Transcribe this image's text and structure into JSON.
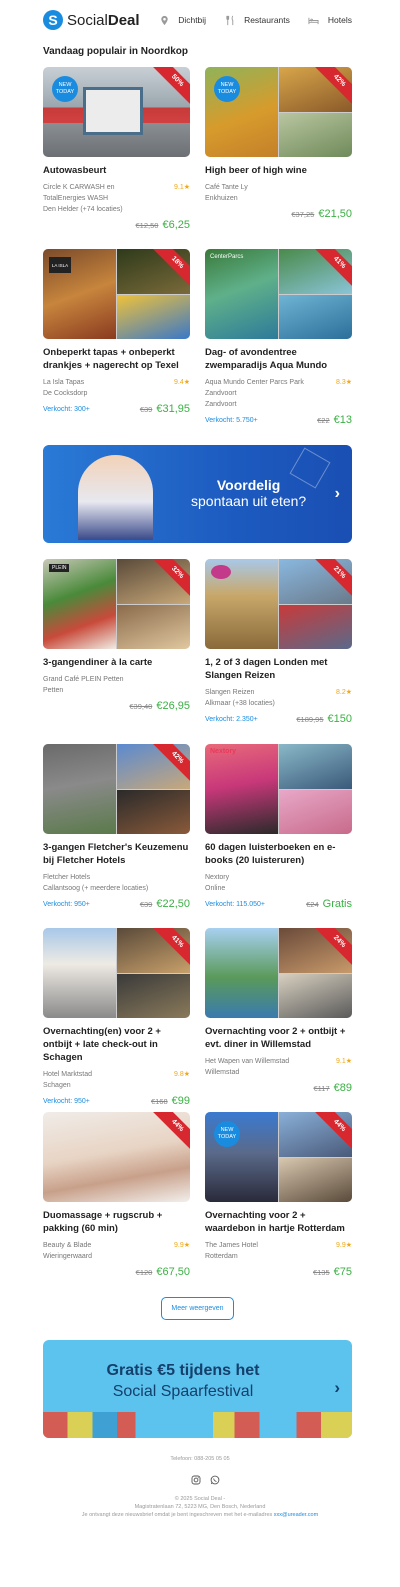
{
  "header": {
    "logo": "S",
    "logo_social": "Social",
    "logo_deal": "Deal",
    "nav": [
      {
        "label": "Dichtbij",
        "icon": "location-pin-icon"
      },
      {
        "label": "Restaurants",
        "icon": "fork-knife-icon"
      },
      {
        "label": "Hotels",
        "icon": "bed-icon"
      }
    ]
  },
  "section_title": "Vandaag populair in Noordkop",
  "deals": [
    {
      "title": "Autowasbeurt",
      "meta": [
        "Circle K CARWASH en",
        "TotalEnergies WASH",
        "Den Helder (+74 locaties)"
      ],
      "rating": "9.1★",
      "sold": "",
      "old_price": "€12,50",
      "new_price": "€6,25",
      "discount": "50%",
      "new_badge": true
    },
    {
      "title": "High beer of high wine",
      "meta": [
        "Café Tante Ly",
        "Enkhuizen"
      ],
      "rating": "",
      "sold": "",
      "old_price": "€37,25",
      "new_price": "€21,50",
      "discount": "42%",
      "new_badge": true
    },
    {
      "title": "Onbeperkt tapas + onbeperkt drankjes + nagerecht op Texel",
      "meta": [
        "La Isla Tapas",
        "De Cocksdorp"
      ],
      "rating": "9.4★",
      "sold": "Verkocht: 300+",
      "old_price": "€39",
      "new_price": "€31,95",
      "discount": "18%",
      "new_badge": false
    },
    {
      "title": "Dag- of avondentree zwemparadijs Aqua Mundo",
      "meta": [
        "Aqua Mundo Center Parcs Park",
        "Zandvoort",
        "Zandvoort"
      ],
      "rating": "8.3★",
      "sold": "Verkocht: 5.750+",
      "old_price": "€22",
      "new_price": "€13",
      "discount": "41%",
      "new_badge": false
    },
    {
      "title": "3-gangendiner à la carte",
      "meta": [
        "Grand Café PLEIN Petten",
        "Petten"
      ],
      "rating": "",
      "sold": "",
      "old_price": "€39,40",
      "new_price": "€26,95",
      "discount": "32%",
      "new_badge": false
    },
    {
      "title": "1, 2 of 3 dagen Londen met Slangen Reizen",
      "meta": [
        "Slangen Reizen",
        "Alkmaar (+38 locaties)"
      ],
      "rating": "8.2★",
      "sold": "Verkocht: 2.350+",
      "old_price": "€189,95",
      "new_price": "€150",
      "discount": "21%",
      "new_badge": false
    },
    {
      "title": "3-gangen Fletcher's Keuzemenu bij Fletcher Hotels",
      "meta": [
        "Fletcher Hotels",
        "Callantsoog (+ meerdere locaties)"
      ],
      "rating": "",
      "sold": "Verkocht: 950+",
      "old_price": "€39",
      "new_price": "€22,50",
      "discount": "42%",
      "new_badge": false
    },
    {
      "title": "60 dagen luisterboeken en e-books (20 luisteruren)",
      "meta": [
        "Nextory",
        "Online"
      ],
      "rating": "",
      "sold": "Verkocht: 115.050+",
      "old_price": "€24",
      "new_price": "Gratis",
      "discount": "",
      "new_badge": false
    },
    {
      "title": "Overnachting(en) voor 2 + ontbijt + late check-out in Schagen",
      "meta": [
        "Hotel Marktstad",
        "Schagen"
      ],
      "rating": "9.8★",
      "sold": "Verkocht: 950+",
      "old_price": "€168",
      "new_price": "€99",
      "discount": "41%",
      "new_badge": false
    },
    {
      "title": "Overnachting voor 2 + ontbijt + evt. diner in Willemstad",
      "meta": [
        "Het Wapen van Willemstad",
        "Willemstad"
      ],
      "rating": "9.1★",
      "sold": "",
      "old_price": "€117",
      "new_price": "€89",
      "discount": "24%",
      "new_badge": false
    },
    {
      "title": "Duomassage + rugscrub + pakking (60 min)",
      "meta": [
        "Beauty & Blade",
        "Wieringerwaard"
      ],
      "rating": "9.9★",
      "sold": "",
      "old_price": "€120",
      "new_price": "€67,50",
      "discount": "44%",
      "new_badge": false
    },
    {
      "title": "Overnachting voor 2 + waardebon in hartje Rotterdam",
      "meta": [
        "The James Hotel",
        "Rotterdam"
      ],
      "rating": "9.9★",
      "sold": "",
      "old_price": "€135",
      "new_price": "€75",
      "discount": "44%",
      "new_badge": true
    }
  ],
  "badges": {
    "new_l1": "NEW",
    "new_l2": "TODAY",
    "center_parcs": "CenterParcs",
    "plein": "PLEIN",
    "nextory": "Nextory",
    "la_isla": "LA ISLA"
  },
  "banner1": {
    "line1": "Voordelig",
    "line2": "spontaan uit eten?"
  },
  "banner2": {
    "line1": "Gratis €5 tijdens het",
    "line2": "Social Spaarfestival"
  },
  "more_button": "Meer weergeven",
  "footer": {
    "phone": "Telefoon: 088-205 05 05",
    "line1": "© 2025 Social Deal -",
    "line2": "Magistratenlaan 72, 5223 MG, Den Bosch, Nederland",
    "line3": "Je ontvangt deze nieuwsbrief omdat je bent ingeschreven met het e-mailadres",
    "email": "xxx@ureader.com"
  },
  "colors": {
    "brand_blue": "#1a8ce0",
    "price_green": "#3bb044",
    "ribbon_red": "#d8282f",
    "rating_orange": "#f0a81c"
  }
}
